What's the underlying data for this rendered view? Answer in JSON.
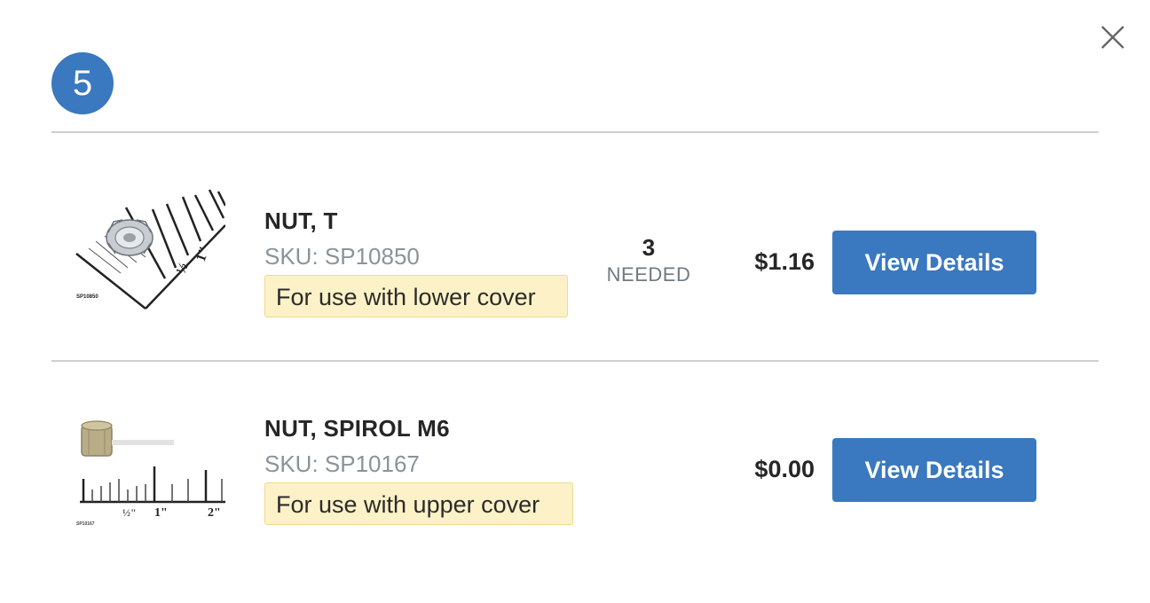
{
  "modal": {
    "step_number": "5",
    "close_icon": "close-icon"
  },
  "parts": [
    {
      "name": "NUT, T",
      "sku": "SKU: SP10850",
      "note": "For use with lower cover",
      "quantity": "3",
      "quantity_label": "NEEDED",
      "price": "$1.16",
      "button_label": "View Details",
      "image_caption": "SP10850",
      "ruler_labels": [
        "½",
        "1\""
      ]
    },
    {
      "name": "NUT, SPIROL M6",
      "sku": "SKU: SP10167",
      "note": "For use with upper cover",
      "price": "$0.00",
      "button_label": "View Details",
      "image_caption": "SP10167",
      "ruler_labels": [
        "½\"",
        "1\"",
        "2\""
      ]
    }
  ],
  "colors": {
    "accent": "#3a78bf",
    "note_bg": "#fdf2c7",
    "divider": "#cfcfcf"
  }
}
